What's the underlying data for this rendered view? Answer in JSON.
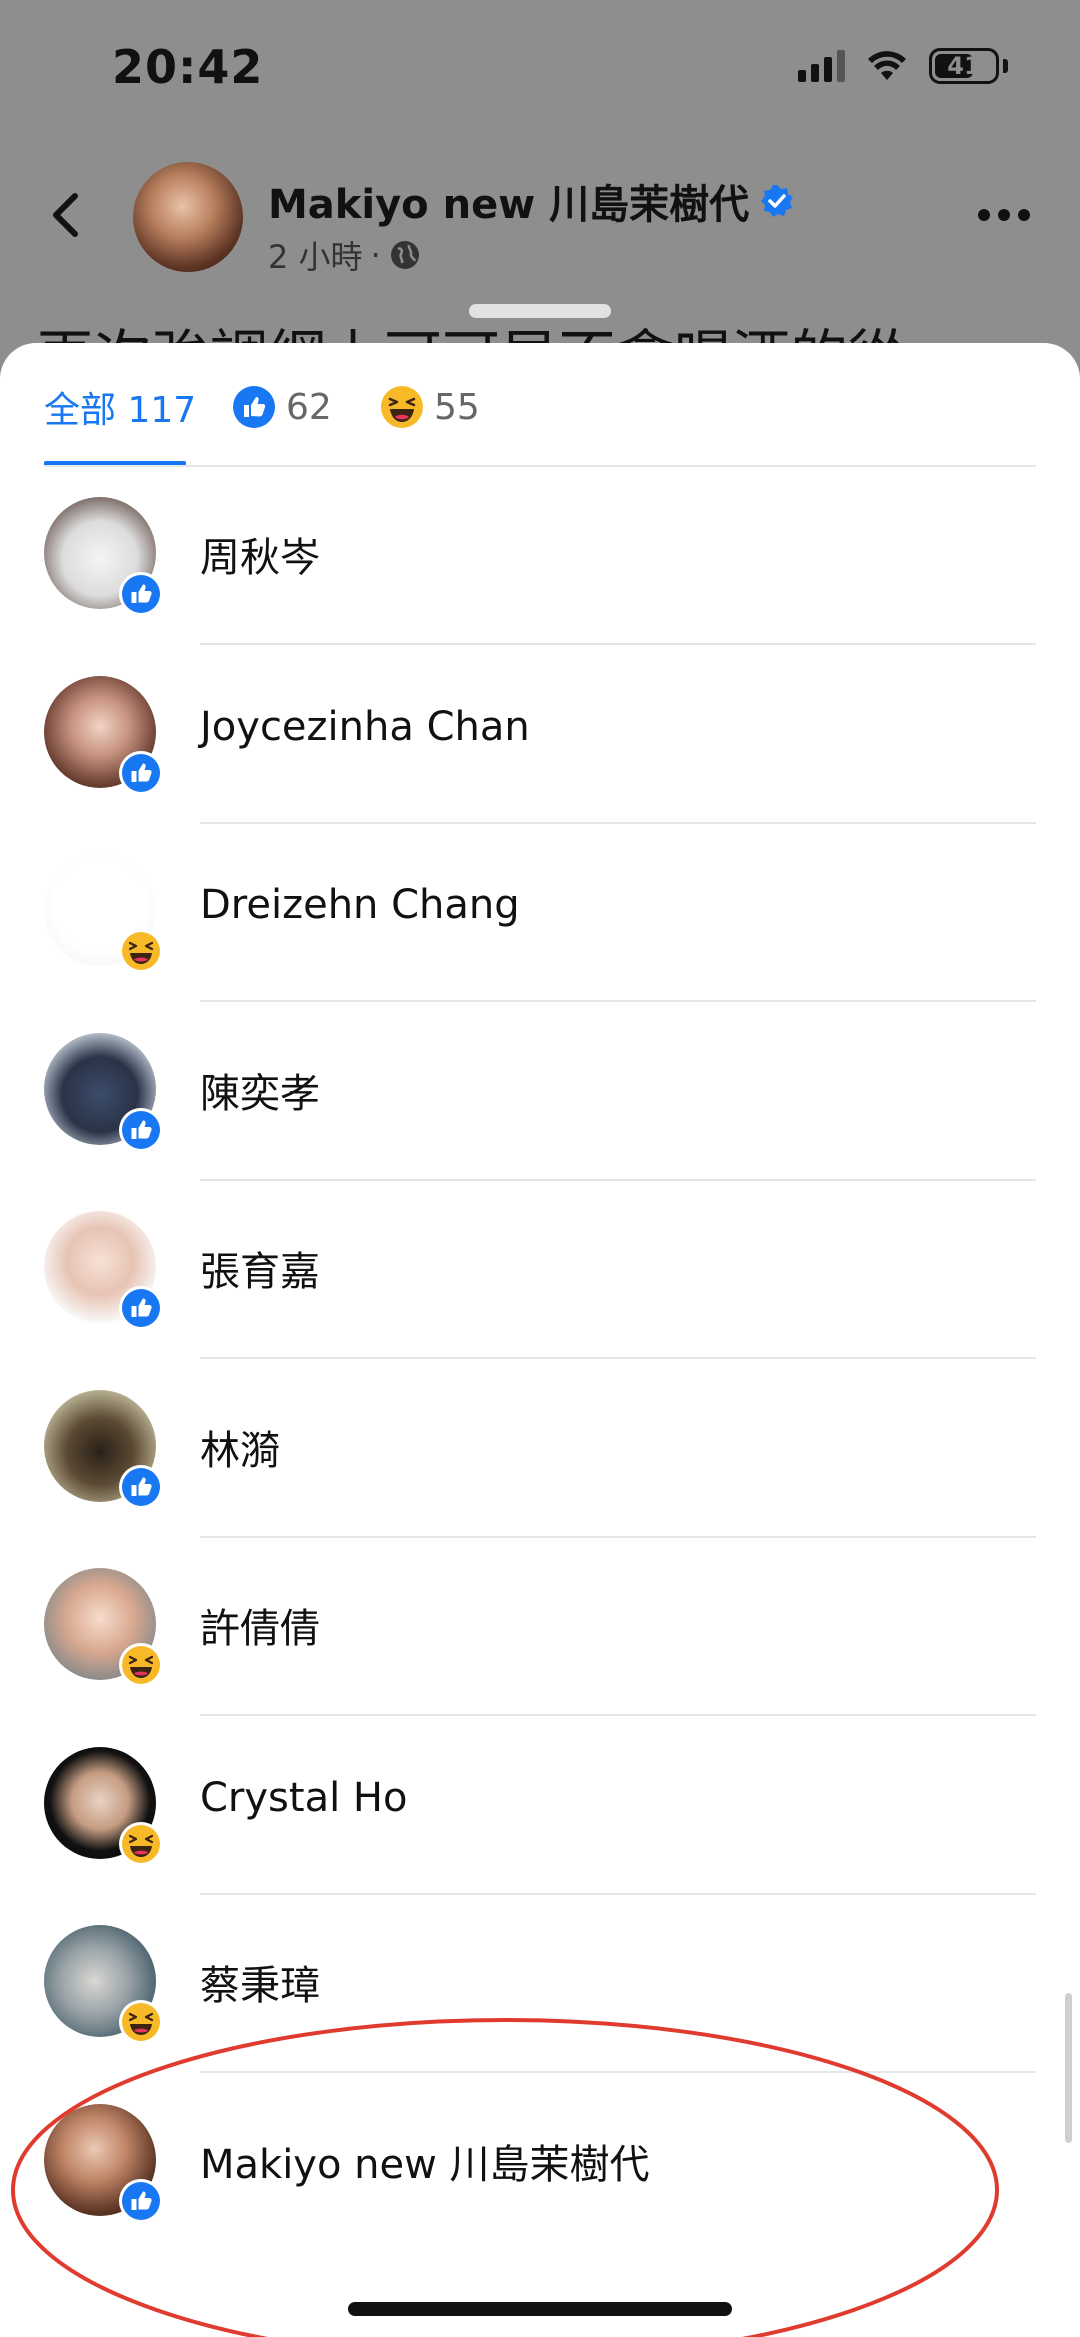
{
  "status_bar": {
    "time": "20:42",
    "battery": "41"
  },
  "post": {
    "poster_name": "Makiyo new 川島茉樹代",
    "timestamp": "2 小時",
    "separator": "·",
    "text_snippet": "再次強調網上可可早不會喝酒的從"
  },
  "tabs": [
    {
      "label": "全部 117",
      "active": true
    },
    {
      "label": "62",
      "reaction": "like"
    },
    {
      "label": "55",
      "reaction": "haha"
    }
  ],
  "reactors": [
    {
      "name": "周秋岑",
      "reaction": "like"
    },
    {
      "name": "Joycezinha Chan",
      "reaction": "like"
    },
    {
      "name": "Dreizehn Chang",
      "reaction": "haha"
    },
    {
      "name": "陳奕孝",
      "reaction": "like"
    },
    {
      "name": "張育嘉",
      "reaction": "like"
    },
    {
      "name": "林漪",
      "reaction": "like"
    },
    {
      "name": "許倩倩",
      "reaction": "haha"
    },
    {
      "name": "Crystal Ho",
      "reaction": "haha"
    },
    {
      "name": "蔡秉璋",
      "reaction": "haha"
    },
    {
      "name": "Makiyo new 川島茉樹代",
      "reaction": "like"
    }
  ],
  "colors": {
    "accent": "#1877f2",
    "highlight": "#e03b2f",
    "haha": "#f7b928"
  }
}
